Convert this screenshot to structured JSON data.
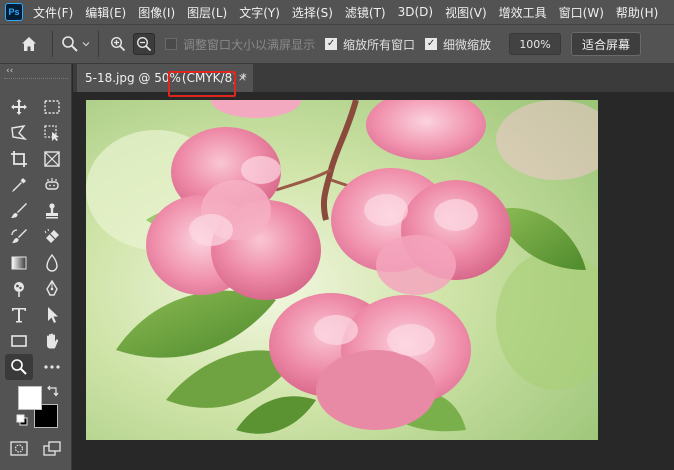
{
  "app": {
    "logo_text": "Ps"
  },
  "menu": {
    "items": [
      "文件(F)",
      "编辑(E)",
      "图像(I)",
      "图层(L)",
      "文字(Y)",
      "选择(S)",
      "滤镜(T)",
      "3D(D)",
      "视图(V)",
      "增效工具",
      "窗口(W)",
      "帮助(H)"
    ]
  },
  "options": {
    "resize_windows_label": "调整窗口大小以满屏显示",
    "resize_windows_checked": false,
    "zoom_all_windows_label": "缩放所有窗口",
    "zoom_all_windows_checked": true,
    "scrubby_zoom_label": "细微缩放",
    "scrubby_zoom_checked": true,
    "percent_button_label": "100%",
    "fit_screen_button_label": "适合屏幕",
    "check_mark": "✓"
  },
  "toolbar": {
    "collapse_label": "‹‹",
    "foreground_color": "#ffffff",
    "background_color": "#000000",
    "tools": [
      "move-tool-icon",
      "marquee-tool-icon",
      "lasso-tool-icon",
      "object-select-tool-icon",
      "crop-tool-icon",
      "frame-tool-icon",
      "eyedropper-tool-icon",
      "spot-heal-tool-icon",
      "brush-tool-icon",
      "stamp-tool-icon",
      "history-brush-tool-icon",
      "eraser-tool-icon",
      "gradient-tool-icon",
      "blur-tool-icon",
      "dodge-tool-icon",
      "pen-tool-icon",
      "type-tool-icon",
      "path-select-tool-icon",
      "rectangle-tool-icon",
      "hand-tool-icon",
      "zoom-tool-icon",
      "more-tools-icon"
    ]
  },
  "document": {
    "tab_name": "5-18.jpg @ 50%",
    "tab_mode": "(CMYK/8) *",
    "tab_close": "×"
  },
  "colors": {
    "highlight_box": "#e0251f",
    "panel": "#535353",
    "canvas_bg": "#282828"
  }
}
